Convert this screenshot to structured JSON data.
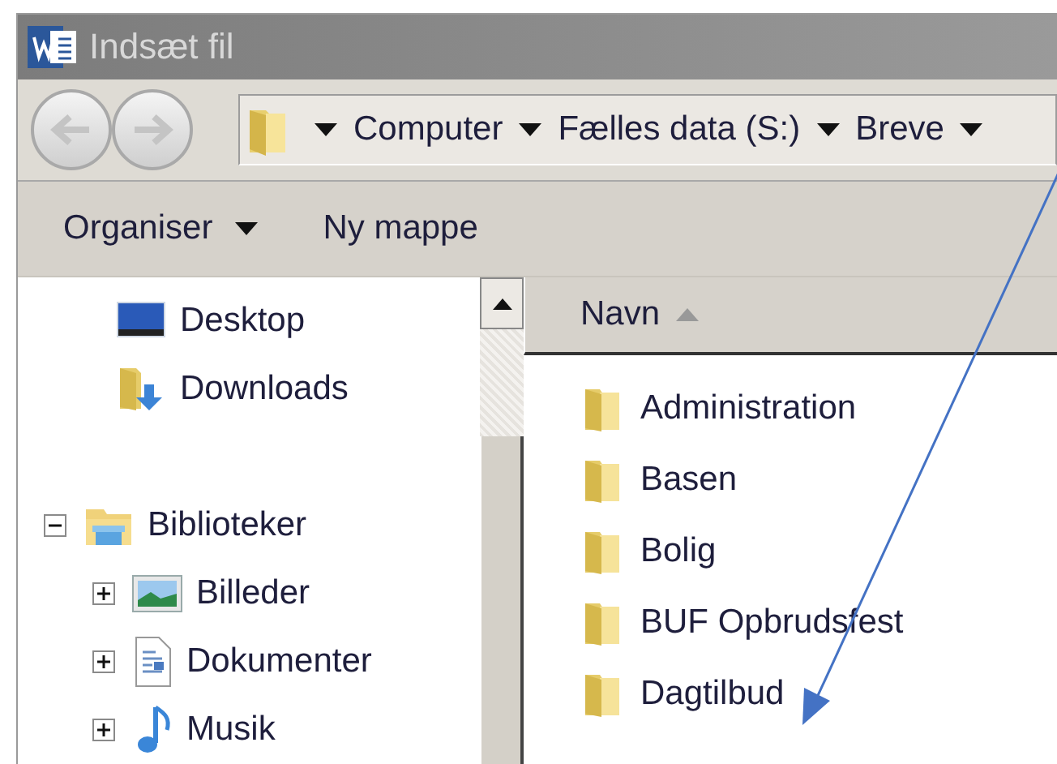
{
  "window": {
    "title": "Indsæt fil"
  },
  "address_bar": {
    "crumbs": [
      "Computer",
      "Fælles data (S:)",
      "Breve"
    ]
  },
  "toolbar": {
    "organize": "Organiser",
    "new_folder": "Ny mappe"
  },
  "sidebar": {
    "items": [
      {
        "label": "Desktop",
        "kind": "desktop"
      },
      {
        "label": "Downloads",
        "kind": "downloads"
      },
      {
        "label": "Biblioteker",
        "kind": "library",
        "expanded": true,
        "children": [
          {
            "label": "Billeder",
            "kind": "pictures",
            "expanded": false
          },
          {
            "label": "Dokumenter",
            "kind": "documents",
            "expanded": false
          },
          {
            "label": "Musik",
            "kind": "music",
            "expanded": false
          }
        ]
      }
    ]
  },
  "file_list": {
    "columns": [
      "Navn"
    ],
    "rows": [
      {
        "name": "Administration"
      },
      {
        "name": "Basen"
      },
      {
        "name": "Bolig"
      },
      {
        "name": "BUF Opbrudsfest"
      },
      {
        "name": "Dagtilbud"
      }
    ]
  }
}
